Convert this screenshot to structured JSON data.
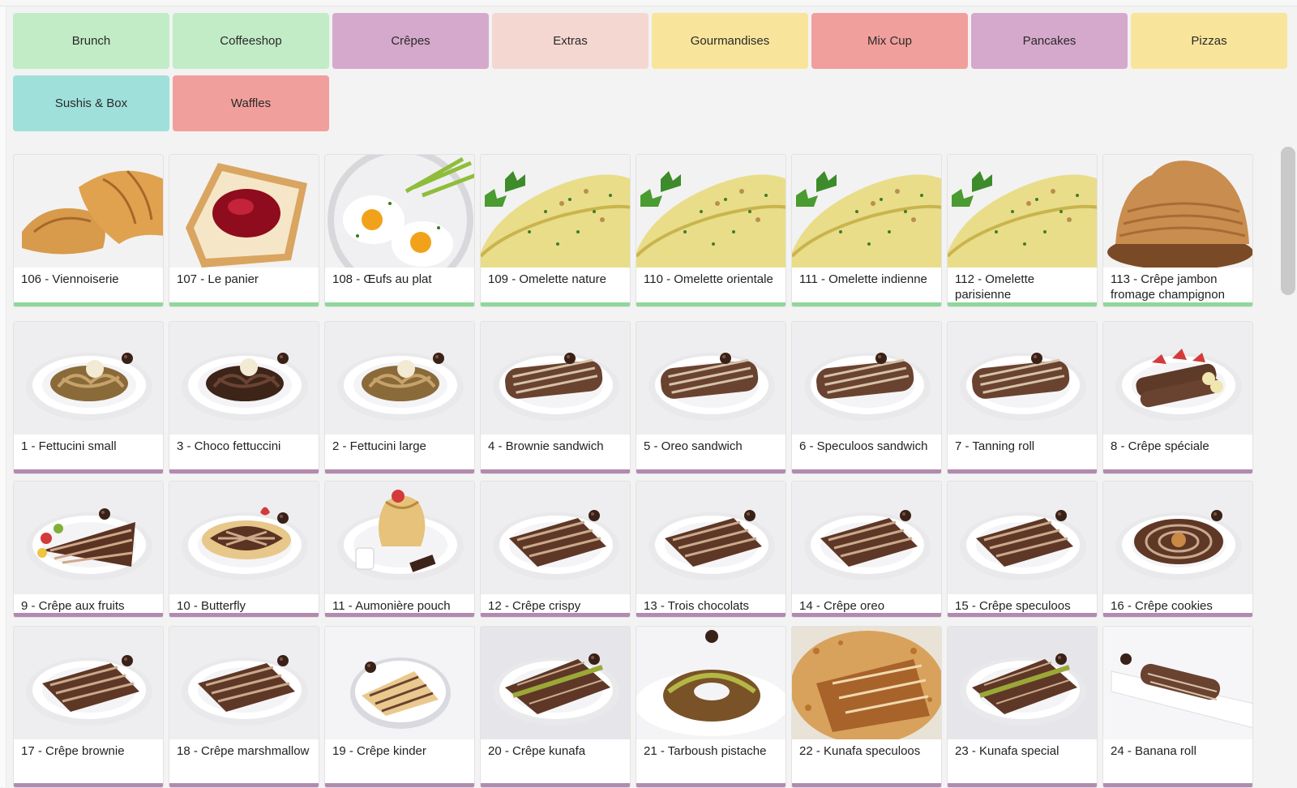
{
  "categories": [
    {
      "label": "Brunch",
      "color": "#c1ecc6"
    },
    {
      "label": "Coffeeshop",
      "color": "#c1ecc6"
    },
    {
      "label": "Crêpes",
      "color": "#d5a9cc"
    },
    {
      "label": "Extras",
      "color": "#f4d7d1"
    },
    {
      "label": "Gourmandises",
      "color": "#f8e59b"
    },
    {
      "label": "Mix Cup",
      "color": "#f19f9c"
    },
    {
      "label": "Pancakes",
      "color": "#d5a9cc"
    },
    {
      "label": "Pizzas",
      "color": "#f8e59b"
    },
    {
      "label": "Sushis & Box",
      "color": "#9fe0db"
    },
    {
      "label": "Waffles",
      "color": "#f19f9c"
    }
  ],
  "products": [
    {
      "label": "106 - Viennoiserie",
      "image": "croissant",
      "accent": "#8fd79b"
    },
    {
      "label": "107 - Le panier",
      "image": "toast-jam",
      "accent": "#8fd79b"
    },
    {
      "label": "108 - Œufs au plat",
      "image": "fried-eggs",
      "accent": "#8fd79b"
    },
    {
      "label": "109 - Omelette nature",
      "image": "omelette",
      "accent": "#8fd79b"
    },
    {
      "label": "110 - Omelette orientale",
      "image": "omelette",
      "accent": "#8fd79b"
    },
    {
      "label": "111 - Omelette indienne",
      "image": "omelette",
      "accent": "#8fd79b"
    },
    {
      "label": "112 - Omelette parisienne",
      "image": "omelette",
      "accent": "#8fd79b"
    },
    {
      "label": "113 - Crêpe jambon fromage champignon",
      "image": "crepe-stack",
      "accent": "#8fd79b"
    },
    {
      "label": "1 - Fettucini small",
      "image": "fettuccini",
      "accent": "#b38ab0"
    },
    {
      "label": "3 - Choco fettuccini",
      "image": "choco-fettuccini",
      "accent": "#b38ab0"
    },
    {
      "label": "2 - Fettucini large",
      "image": "fettuccini",
      "accent": "#b38ab0"
    },
    {
      "label": "4 - Brownie sandwich",
      "image": "roll",
      "accent": "#b38ab0"
    },
    {
      "label": "5 - Oreo sandwich",
      "image": "roll",
      "accent": "#b38ab0"
    },
    {
      "label": "6 - Speculoos sandwich",
      "image": "roll",
      "accent": "#b38ab0"
    },
    {
      "label": "7 - Tanning roll",
      "image": "roll",
      "accent": "#b38ab0"
    },
    {
      "label": "8 - Crêpe spéciale",
      "image": "special",
      "accent": "#b38ab0"
    },
    {
      "label": "9 - Crêpe aux fruits",
      "image": "crepe-fruits",
      "accent": "#b38ab0"
    },
    {
      "label": "10 - Butterfly",
      "image": "butterfly",
      "accent": "#b38ab0"
    },
    {
      "label": "11 - Aumonière pouch",
      "image": "pouch",
      "accent": "#b38ab0"
    },
    {
      "label": "12 - Crêpe crispy",
      "image": "crepe",
      "accent": "#b38ab0"
    },
    {
      "label": "13 - Trois chocolats",
      "image": "crepe",
      "accent": "#b38ab0"
    },
    {
      "label": "14 - Crêpe oreo",
      "image": "crepe",
      "accent": "#b38ab0"
    },
    {
      "label": "15 - Crêpe speculoos",
      "image": "crepe",
      "accent": "#b38ab0"
    },
    {
      "label": "16 - Crêpe cookies",
      "image": "crepe-swirl",
      "accent": "#b38ab0"
    },
    {
      "label": "17 - Crêpe brownie",
      "image": "crepe",
      "accent": "#b38ab0"
    },
    {
      "label": "18 - Crêpe marshmallow",
      "image": "crepe",
      "accent": "#b38ab0"
    },
    {
      "label": "19 - Crêpe kinder",
      "image": "crepe-light",
      "accent": "#b38ab0"
    },
    {
      "label": "20 - Crêpe kunafa",
      "image": "kunafa",
      "accent": "#b38ab0"
    },
    {
      "label": "21 - Tarboush pistache",
      "image": "tarboush",
      "accent": "#b38ab0"
    },
    {
      "label": "22 - Kunafa speculoos",
      "image": "kunafa-speculoos",
      "accent": "#b38ab0"
    },
    {
      "label": "23 - Kunafa special",
      "image": "kunafa",
      "accent": "#b38ab0"
    },
    {
      "label": "24 - Banana roll",
      "image": "banana-roll",
      "accent": "#b38ab0"
    }
  ]
}
